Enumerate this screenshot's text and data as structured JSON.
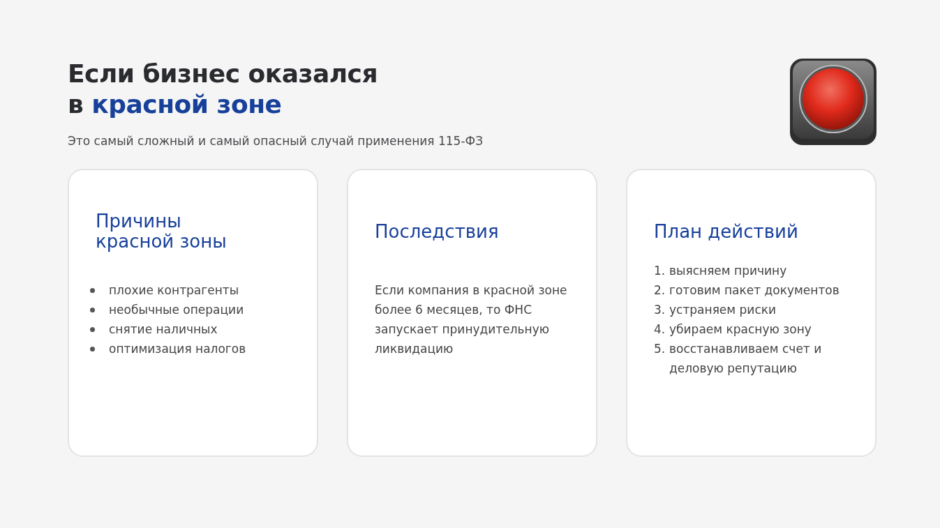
{
  "header": {
    "title_lead": "Если бизнес оказался\nв ",
    "title_accent": "красной зоне",
    "subtitle": "Это самый сложный и самый опасный случай применения 115-ФЗ"
  },
  "cards": [
    {
      "kind": "bullets",
      "title": "Причины\nкрасной зоны",
      "items": [
        "плохие контрагенты",
        "необычные операции",
        "снятие наличных",
        "оптимизация налогов"
      ]
    },
    {
      "kind": "paragraph",
      "title": "Последствия",
      "text": "Если компания в красной зоне более 6 месяцев, то ФНС запускает принудительную ликвидацию"
    },
    {
      "kind": "numbered",
      "title": "План действий",
      "items": [
        {
          "number": "1.",
          "text": "выясняем причину"
        },
        {
          "number": "2.",
          "text": "готовим пакет документов"
        },
        {
          "number": "3.",
          "text": "устраняем риски"
        },
        {
          "number": "4.",
          "text": "убираем красную зону"
        },
        {
          "number": "5.",
          "text": "восстанавливаем счет и деловую репутацию"
        }
      ]
    }
  ]
}
